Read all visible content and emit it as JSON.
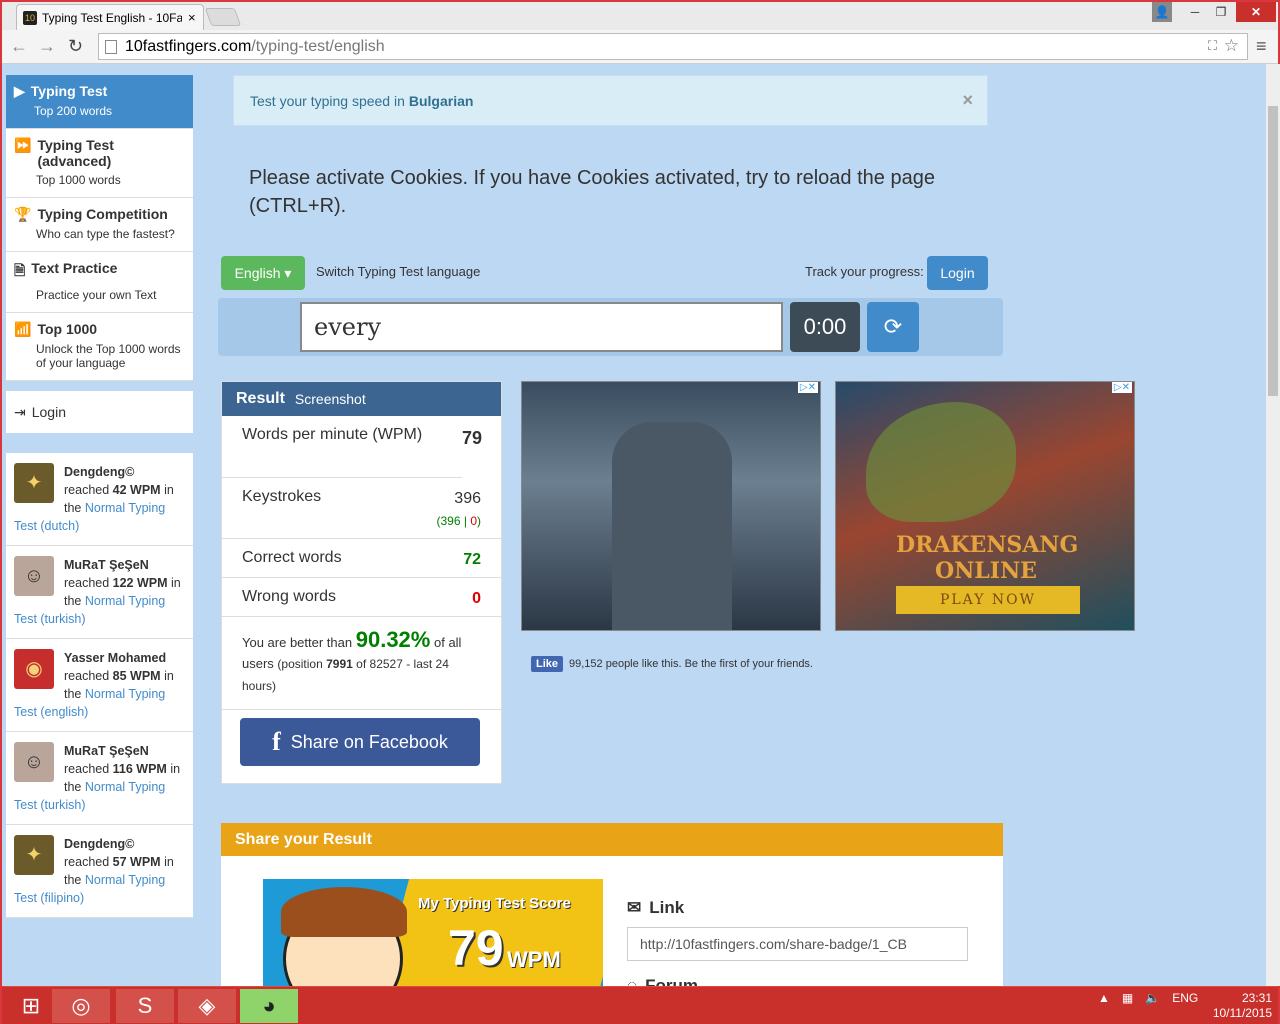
{
  "browser": {
    "tab_title": "Typing Test English - 10Fa",
    "tab_close": "×",
    "url_domain": "10fastfingers.com",
    "url_path": "/typing-test/english",
    "window_min": "─",
    "window_max": "❐",
    "window_close": "✕"
  },
  "sidebar": {
    "items": [
      {
        "label": "Typing Test",
        "sub": "Top 200 words",
        "icon": "▶"
      },
      {
        "label": "Typing Test (advanced)",
        "sub": "Top 1000 words",
        "icon": "⏩"
      },
      {
        "label": "Typing Competition",
        "sub": "Who can type the fastest?",
        "icon": "🏆"
      },
      {
        "label": "Text Practice",
        "sub": "Practice your own Text",
        "icon": "🗎"
      },
      {
        "label": "Top 1000",
        "sub": "Unlock the Top 1000 words of your language",
        "icon": "📶"
      }
    ],
    "login": "Login",
    "feed": [
      {
        "name": "Dengdeng©",
        "pre": "reached ",
        "wpm": "42 WPM",
        "mid": " in the ",
        "link": "Normal Typing Test (dutch)"
      },
      {
        "name": "MuRaT ŞeŞeN",
        "pre": "reached ",
        "wpm": "122 WPM",
        "mid": " in the ",
        "link": "Normal Typing Test (turkish)"
      },
      {
        "name": "Yasser Mohamed",
        "pre": "reached ",
        "wpm": "85 WPM",
        "mid": " in the ",
        "link": "Normal Typing Test (english)"
      },
      {
        "name": "MuRaT ŞeŞeN",
        "pre": "reached ",
        "wpm": "116 WPM",
        "mid": " in the ",
        "link": "Normal Typing Test (turkish)"
      },
      {
        "name": "Dengdeng©",
        "pre": "reached ",
        "wpm": "57 WPM",
        "mid": " in the ",
        "link": "Normal Typing Test (filipino)"
      }
    ]
  },
  "notice": {
    "text": "Test your typing speed in",
    "lang": "Bulgarian",
    "close": "×"
  },
  "cookie_msg": "Please activate Cookies. If you have Cookies activated, try to reload the page (CTRL+R).",
  "controls": {
    "lang_btn": "English ▾",
    "switch_label": "Switch Typing Test language",
    "track_label": "Track your progress:",
    "login_btn": "Login",
    "current_word": "every",
    "timer": "0:00",
    "reload_icon": "⟳"
  },
  "result": {
    "title": "Result",
    "screenshot": "Screenshot",
    "wpm_label": "Words per minute (WPM)",
    "wpm": "79",
    "keystrokes_label": "Keystrokes",
    "keystrokes": "396",
    "ks_correct": "396",
    "ks_wrong": "0",
    "correct_label": "Correct words",
    "correct": "72",
    "wrong_label": "Wrong words",
    "wrong": "0",
    "better_pre": "You are better than",
    "better_pct": "90.32%",
    "better_post": "of all users",
    "position_pre": "(position",
    "position": "7991",
    "position_post": "of 82527 - last 24 hours)",
    "share_fb": "Share on Facebook"
  },
  "ads": {
    "ad2_logo": "DRAKENSANG ONLINE",
    "ad2_play": "PLAY NOW"
  },
  "fb_like": {
    "btn": "Like",
    "text": "99,152 people like this. Be the first of your friends."
  },
  "share": {
    "title": "Share your Result",
    "badge_title": "My Typing Test Score",
    "badge_num": "79",
    "badge_unit": "WPM",
    "link_label": "Link",
    "link_value": "http://10fastfingers.com/share-badge/1_CB",
    "forum_label": "Forum"
  },
  "taskbar": {
    "lang": "ENG",
    "time": "23:31",
    "date": "10/11/2015"
  }
}
